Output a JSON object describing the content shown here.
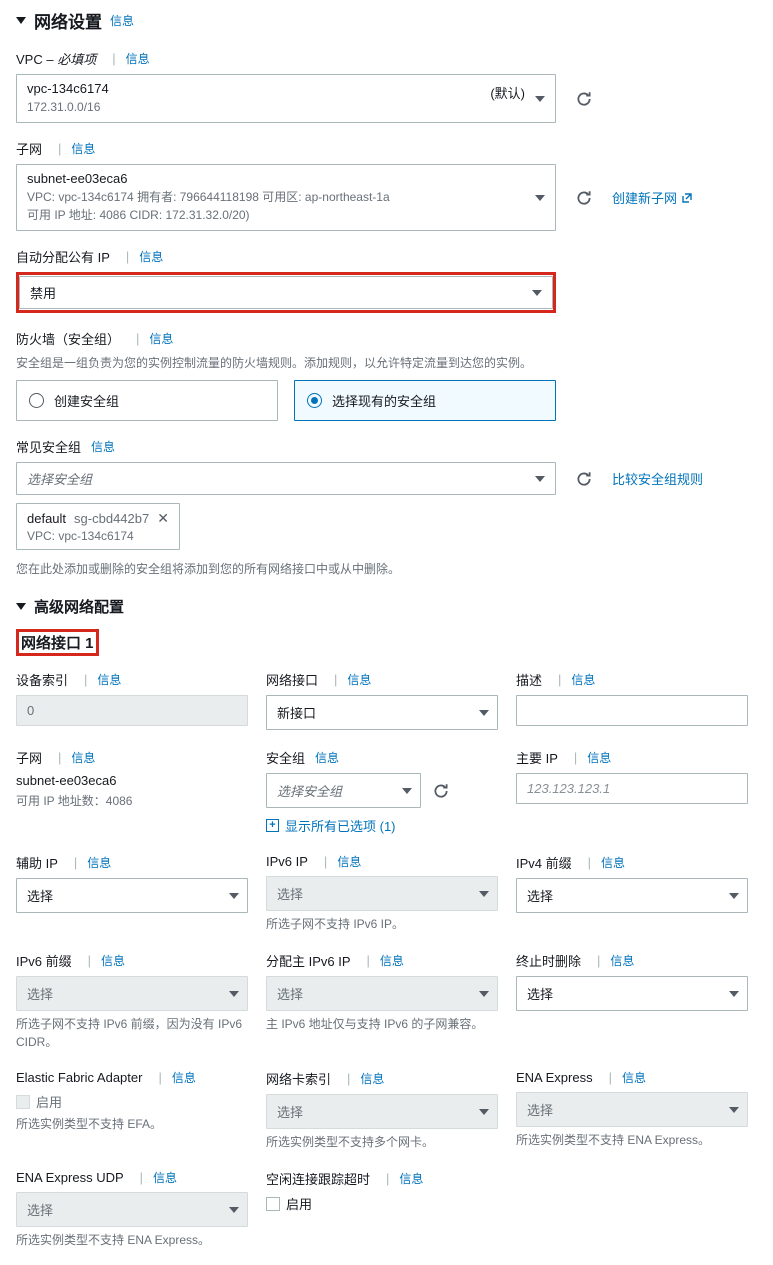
{
  "header": {
    "title": "网络设置",
    "info": "信息"
  },
  "vpc": {
    "label": "VPC",
    "required_suffix": "– 必填项",
    "info": "信息",
    "value": "vpc-134c6174",
    "default_label": "(默认)",
    "sub": "172.31.0.0/16"
  },
  "subnet": {
    "label": "子网",
    "info": "信息",
    "value": "subnet-ee03eca6",
    "details": "VPC: vpc-134c6174    拥有者: 796644118198    可用区: ap-northeast-1a",
    "details2": "可用 IP 地址: 4086    CIDR: 172.31.32.0/20)",
    "create_link": "创建新子网"
  },
  "auto_ip": {
    "label": "自动分配公有 IP",
    "info": "信息",
    "value": "禁用"
  },
  "firewall": {
    "label": "防火墙（安全组）",
    "info": "信息",
    "hint": "安全组是一组负责为您的实例控制流量的防火墙规则。添加规则，以允许特定流量到达您的实例。",
    "opt_create": "创建安全组",
    "opt_existing": "选择现有的安全组"
  },
  "common_sg": {
    "label": "常见安全组",
    "info": "信息",
    "placeholder": "选择安全组",
    "compare_link": "比较安全组规则",
    "tag_name": "default",
    "tag_id": "sg-cbd442b7",
    "tag_sub": "VPC: vpc-134c6174",
    "tag_hint": "您在此处添加或删除的安全组将添加到您的所有网络接口中或从中删除。"
  },
  "adv": {
    "title": "高级网络配置"
  },
  "nic": {
    "title": "网络接口 1",
    "device_index": {
      "label": "设备索引",
      "info": "信息",
      "value": "0"
    },
    "interface": {
      "label": "网络接口",
      "info": "信息",
      "value": "新接口"
    },
    "description": {
      "label": "描述",
      "info": "信息"
    },
    "subnet": {
      "label": "子网",
      "info": "信息",
      "value": "subnet-ee03eca6",
      "sub": "可用 IP 地址数：4086"
    },
    "sg": {
      "label": "安全组",
      "info": "信息",
      "placeholder": "选择安全组",
      "show_all": "显示所有已选项 (1)"
    },
    "primary_ip": {
      "label": "主要 IP",
      "info": "信息",
      "placeholder": "123.123.123.1"
    },
    "secondary_ip": {
      "label": "辅助 IP",
      "info": "信息",
      "value": "选择"
    },
    "ipv6_ip": {
      "label": "IPv6 IP",
      "info": "信息",
      "value": "选择",
      "hint": "所选子网不支持 IPv6 IP。"
    },
    "ipv4_prefix": {
      "label": "IPv4 前缀",
      "info": "信息",
      "value": "选择"
    },
    "ipv6_prefix": {
      "label": "IPv6 前缀",
      "info": "信息",
      "value": "选择",
      "hint": "所选子网不支持 IPv6 前缀，因为没有 IPv6 CIDR。"
    },
    "assign_ipv6": {
      "label": "分配主 IPv6 IP",
      "info": "信息",
      "value": "选择",
      "hint": "主 IPv6 地址仅与支持 IPv6 的子网兼容。"
    },
    "delete_on_term": {
      "label": "终止时删除",
      "info": "信息",
      "value": "选择"
    },
    "efa": {
      "label": "Elastic Fabric Adapter",
      "info": "信息",
      "check_label": "启用",
      "hint": "所选实例类型不支持 EFA。"
    },
    "card_index": {
      "label": "网络卡索引",
      "info": "信息",
      "value": "选择",
      "hint": "所选实例类型不支持多个网卡。"
    },
    "ena_express": {
      "label": "ENA Express",
      "info": "信息",
      "value": "选择",
      "hint": "所选实例类型不支持 ENA Express。"
    },
    "ena_udp": {
      "label": "ENA Express UDP",
      "info": "信息",
      "value": "选择",
      "hint": "所选实例类型不支持 ENA Express。"
    },
    "idle_timeout": {
      "label": "空闲连接跟踪超时",
      "info": "信息",
      "check_label": "启用"
    }
  }
}
